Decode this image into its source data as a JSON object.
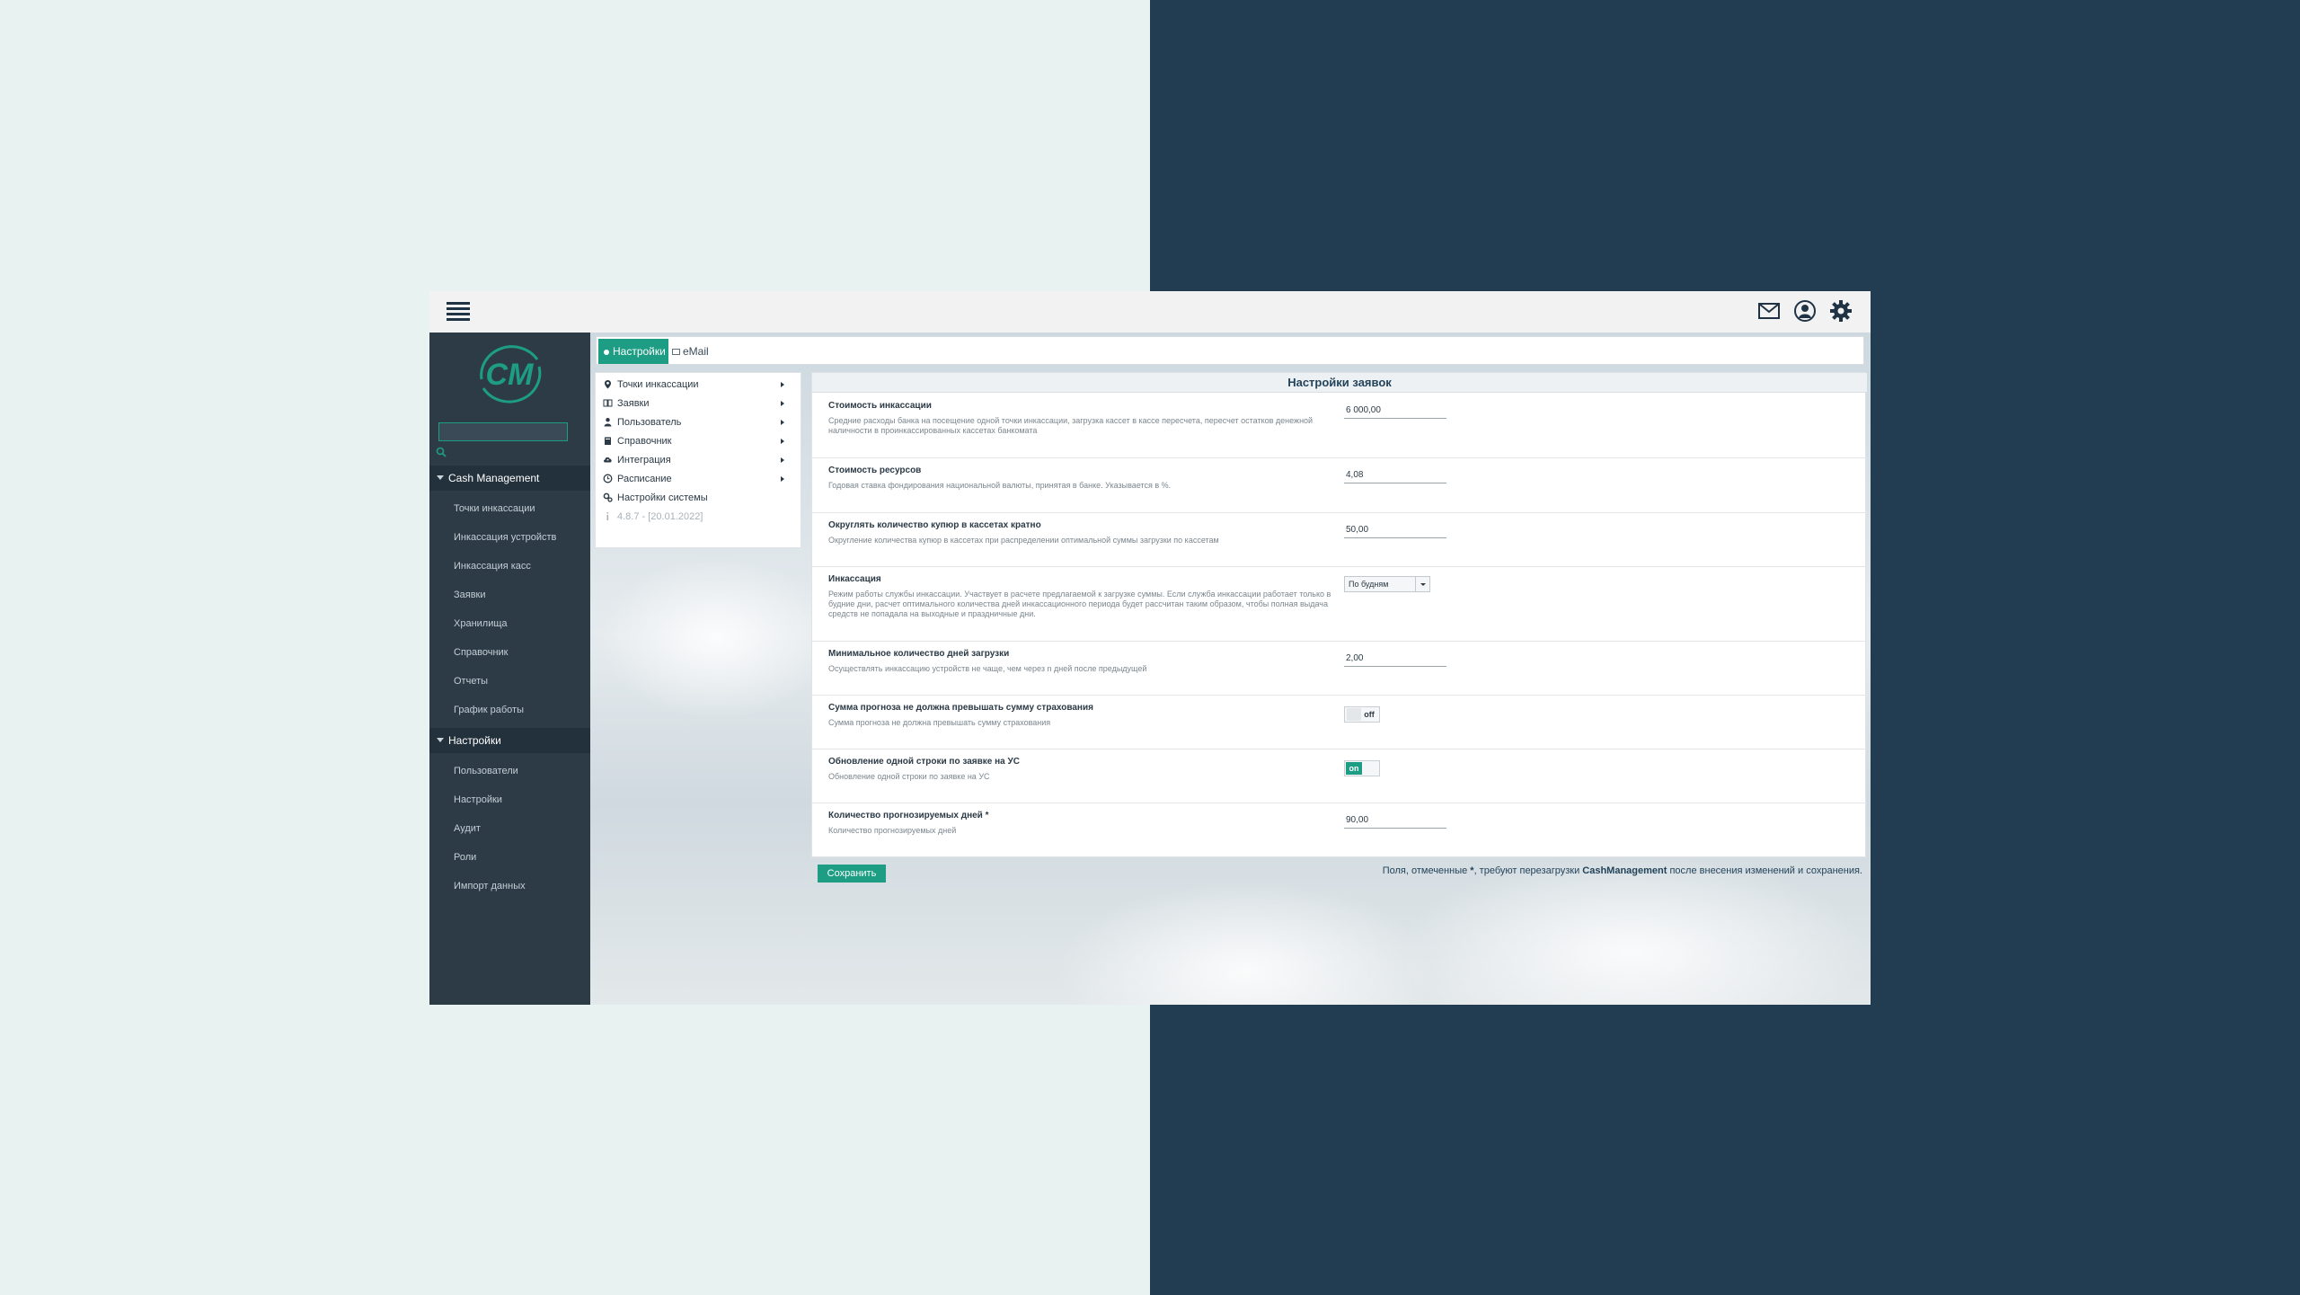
{
  "colors": {
    "accent": "#1d9d84",
    "sidebar_bg": "#2d3b47",
    "left_bg": "#e8f2f1",
    "right_bg": "#223d51",
    "title_text": "#23435a"
  },
  "topbar": {
    "icons": [
      "menu-icon",
      "mail-icon",
      "user-icon",
      "gear-icon"
    ]
  },
  "sidebar": {
    "logo_text": "CM",
    "search_value": "",
    "sections": [
      {
        "title": "Cash Management",
        "items": [
          "Точки инкассации",
          "Инкассация устройств",
          "Инкассация касс",
          "Заявки",
          "Хранилища",
          "Справочник",
          "Отчеты",
          "График работы"
        ]
      },
      {
        "title": "Настройки",
        "items": [
          "Пользователи",
          "Настройки",
          "Аудит",
          "Роли",
          "Импорт данных"
        ]
      }
    ]
  },
  "tabs": [
    {
      "label": "Настройки",
      "active": true
    },
    {
      "label": "eMail",
      "active": false
    }
  ],
  "submenu": [
    {
      "label": "Точки инкассации",
      "icon": "map-pin-icon",
      "has_arrow": true
    },
    {
      "label": "Заявки",
      "icon": "book-icon",
      "has_arrow": true
    },
    {
      "label": "Пользователь",
      "icon": "person-icon",
      "has_arrow": true
    },
    {
      "label": "Справочник",
      "icon": "book-closed-icon",
      "has_arrow": true
    },
    {
      "label": "Интеграция",
      "icon": "cloud-upload-icon",
      "has_arrow": true
    },
    {
      "label": "Расписание",
      "icon": "clock-icon",
      "has_arrow": true
    },
    {
      "label": "Настройки системы",
      "icon": "gears-icon",
      "has_arrow": false
    },
    {
      "label": "4.8.7 - [20.01.2022]",
      "icon": "info-icon",
      "has_arrow": false
    }
  ],
  "panel": {
    "title": "Настройки заявок",
    "rows": [
      {
        "label": "Стоимость инкассации",
        "desc": "Средние расходы банка на посещение одной точки инкассации, загрузка кассет в кассе пересчета, пересчет остатков денежной наличности в проинкассированных кассетах банкомата",
        "value": "6 000,00"
      },
      {
        "label": "Стоимость ресурсов",
        "desc": "Годовая ставка фондирования национальной валюты, принятая в банке. Указывается в %.",
        "value": "4,08"
      },
      {
        "label": "Округлять количество купюр в кассетах кратно",
        "desc": "Округление количества купюр в кассетах при распределении оптимальной суммы загрузки по кассетам",
        "value": "50,00"
      },
      {
        "label": "Инкассация",
        "desc": "Режим работы службы инкассации. Участвует в расчете предлагаемой к загрузке суммы. Если служба инкассации работает только в будние дни, расчет оптимального количества дней инкассационного периода будет рассчитан таким образом, чтобы полная выдача средств не попадала на выходные и праздничные дни.",
        "select": "По будням"
      },
      {
        "label": "Минимальное количество дней загрузки",
        "desc": "Осуществлять инкассацию устройств не чаще, чем через n дней после предыдущей",
        "value": "2,00"
      },
      {
        "label": "Сумма прогноза не должна превышать сумму страхования",
        "desc": "Сумма прогноза не должна превышать сумму страхования",
        "toggle": "off"
      },
      {
        "label": "Обновление одной строки по заявке на УС",
        "desc": "Обновление одной строки по заявке на УС",
        "toggle": "on"
      },
      {
        "label": "Количество прогнозируемых дней *",
        "desc": "Количество прогнозируемых дней",
        "value": "90,00"
      }
    ]
  },
  "save_button": "Сохранить",
  "footnote": {
    "part1": "Поля, отмеченные ",
    "star": "*",
    "part2": ", требуют перезагрузки ",
    "app": "CashManagement",
    "part3": " после внесения изменений и сохранения."
  }
}
